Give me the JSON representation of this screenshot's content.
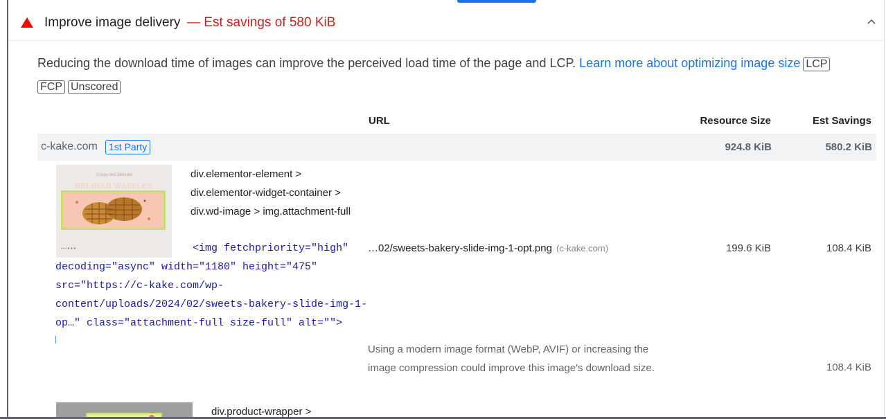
{
  "audit": {
    "title": "Improve image delivery",
    "savings": "— Est savings of 580 KiB",
    "description": "Reducing the download time of images can improve the perceived load time of the page and LCP.",
    "learn_more": "Learn more about optimizing image size",
    "tags": [
      "LCP",
      "FCP",
      "Unscored"
    ]
  },
  "table": {
    "headers": {
      "url": "URL",
      "resource_size": "Resource Size",
      "est_savings": "Est Savings"
    },
    "group": {
      "entity": "c-kake.com",
      "badge": "1st Party",
      "resource_size": "924.8 KiB",
      "est_savings": "580.2 KiB"
    },
    "item": {
      "thumbnail": {
        "script_text": "Crispy and Delicate",
        "title": "BELGIAN WAFFLES"
      },
      "node_path": "div.elementor-element > div.elementor-widget-container > div.wd-image > img.attachment-full",
      "snippet": "                      <img fetchpriority=\"high\"\ndecoding=\"async\" width=\"1180\" height=\"475\"\nsrc=\"https://c-kake.com/wp-\ncontent/uploads/2024/02/sweets-bakery-slide-img-1-\nop…\" class=\"attachment-full size-full\" alt=\"\">",
      "url": "…02/sweets-bakery-slide-img-1-opt.png",
      "host": "(c-kake.com)",
      "resource_size": "199.6 KiB",
      "est_savings": "108.4 KiB",
      "subitem": {
        "text": "Using a modern image format (WebP, AVIF) or increasing the image compression could improve this image's download size.",
        "est_savings": "108.4 KiB"
      }
    },
    "next_item": {
      "node_path": "div.product-wrapper >"
    }
  },
  "colors": {
    "fail": "#eb0f00",
    "savings": "#c5221f",
    "link": "#1a73e8",
    "code": "#1a1aa6"
  }
}
